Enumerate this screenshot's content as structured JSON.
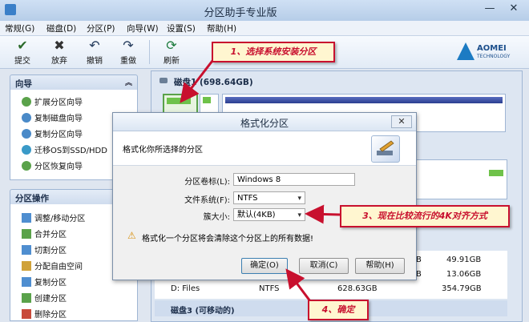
{
  "window": {
    "title": "分区助手专业版",
    "minimize": "—",
    "close": "✕"
  },
  "menu": [
    "常规(G)",
    "磁盘(D)",
    "分区(P)",
    "向导(W)",
    "设置(S)",
    "帮助(H)"
  ],
  "toolbar": {
    "submit": "提交",
    "discard": "放弃",
    "undo": "撤销",
    "redo": "重做",
    "refresh": "刷新"
  },
  "logo": {
    "line1": "AOMEI",
    "line2": "TECHNOLOGY"
  },
  "wizard_panel": {
    "title": "向导",
    "collapse": "︽",
    "items": [
      "扩展分区向导",
      "复制磁盘向导",
      "复制分区向导",
      "迁移OS到SSD/HDD",
      "分区恢复向导"
    ]
  },
  "partition_panel": {
    "title": "分区操作",
    "collapse": "︽",
    "items": [
      "调整/移动分区",
      "合并分区",
      "切割分区",
      "分配自由空间",
      "复制分区",
      "创建分区",
      "删除分区"
    ]
  },
  "disk_area": {
    "disk1_label": "磁盘1 (698.64GB)",
    "disk3_label": "磁盘3 (可移动的)"
  },
  "disk_rows": [
    {
      "name": "",
      "fs": "",
      "capacity": "B",
      "free": "49.91GB"
    },
    {
      "name": "",
      "fs": "",
      "capacity": "B",
      "free": "13.06GB"
    },
    {
      "name": "D: Files",
      "fs": "NTFS",
      "capacity": "628.63GB",
      "free": "354.79GB"
    }
  ],
  "dialog": {
    "title": "格式化分区",
    "close": "✕",
    "description": "格式化你所选择的分区",
    "label_volume": "分区卷标(L):",
    "value_volume": "Windows 8",
    "label_fs": "文件系统(F):",
    "value_fs": "NTFS",
    "label_cluster": "簇大小:",
    "value_cluster": "默认(4KB)",
    "warning": "格式化一个分区将会清除这个分区上的所有数据!",
    "ok": "确定(O)",
    "cancel": "取消(C)",
    "help": "帮助(H)"
  },
  "callouts": {
    "c1": "1、选择系统安装分区",
    "c3": "3、现在比较流行的4K对齐方式",
    "c4": "4、确定"
  },
  "colors": {
    "callout_border": "#c8102e",
    "callout_fill": "#fff6d0",
    "accent": "#1c7bc3"
  }
}
